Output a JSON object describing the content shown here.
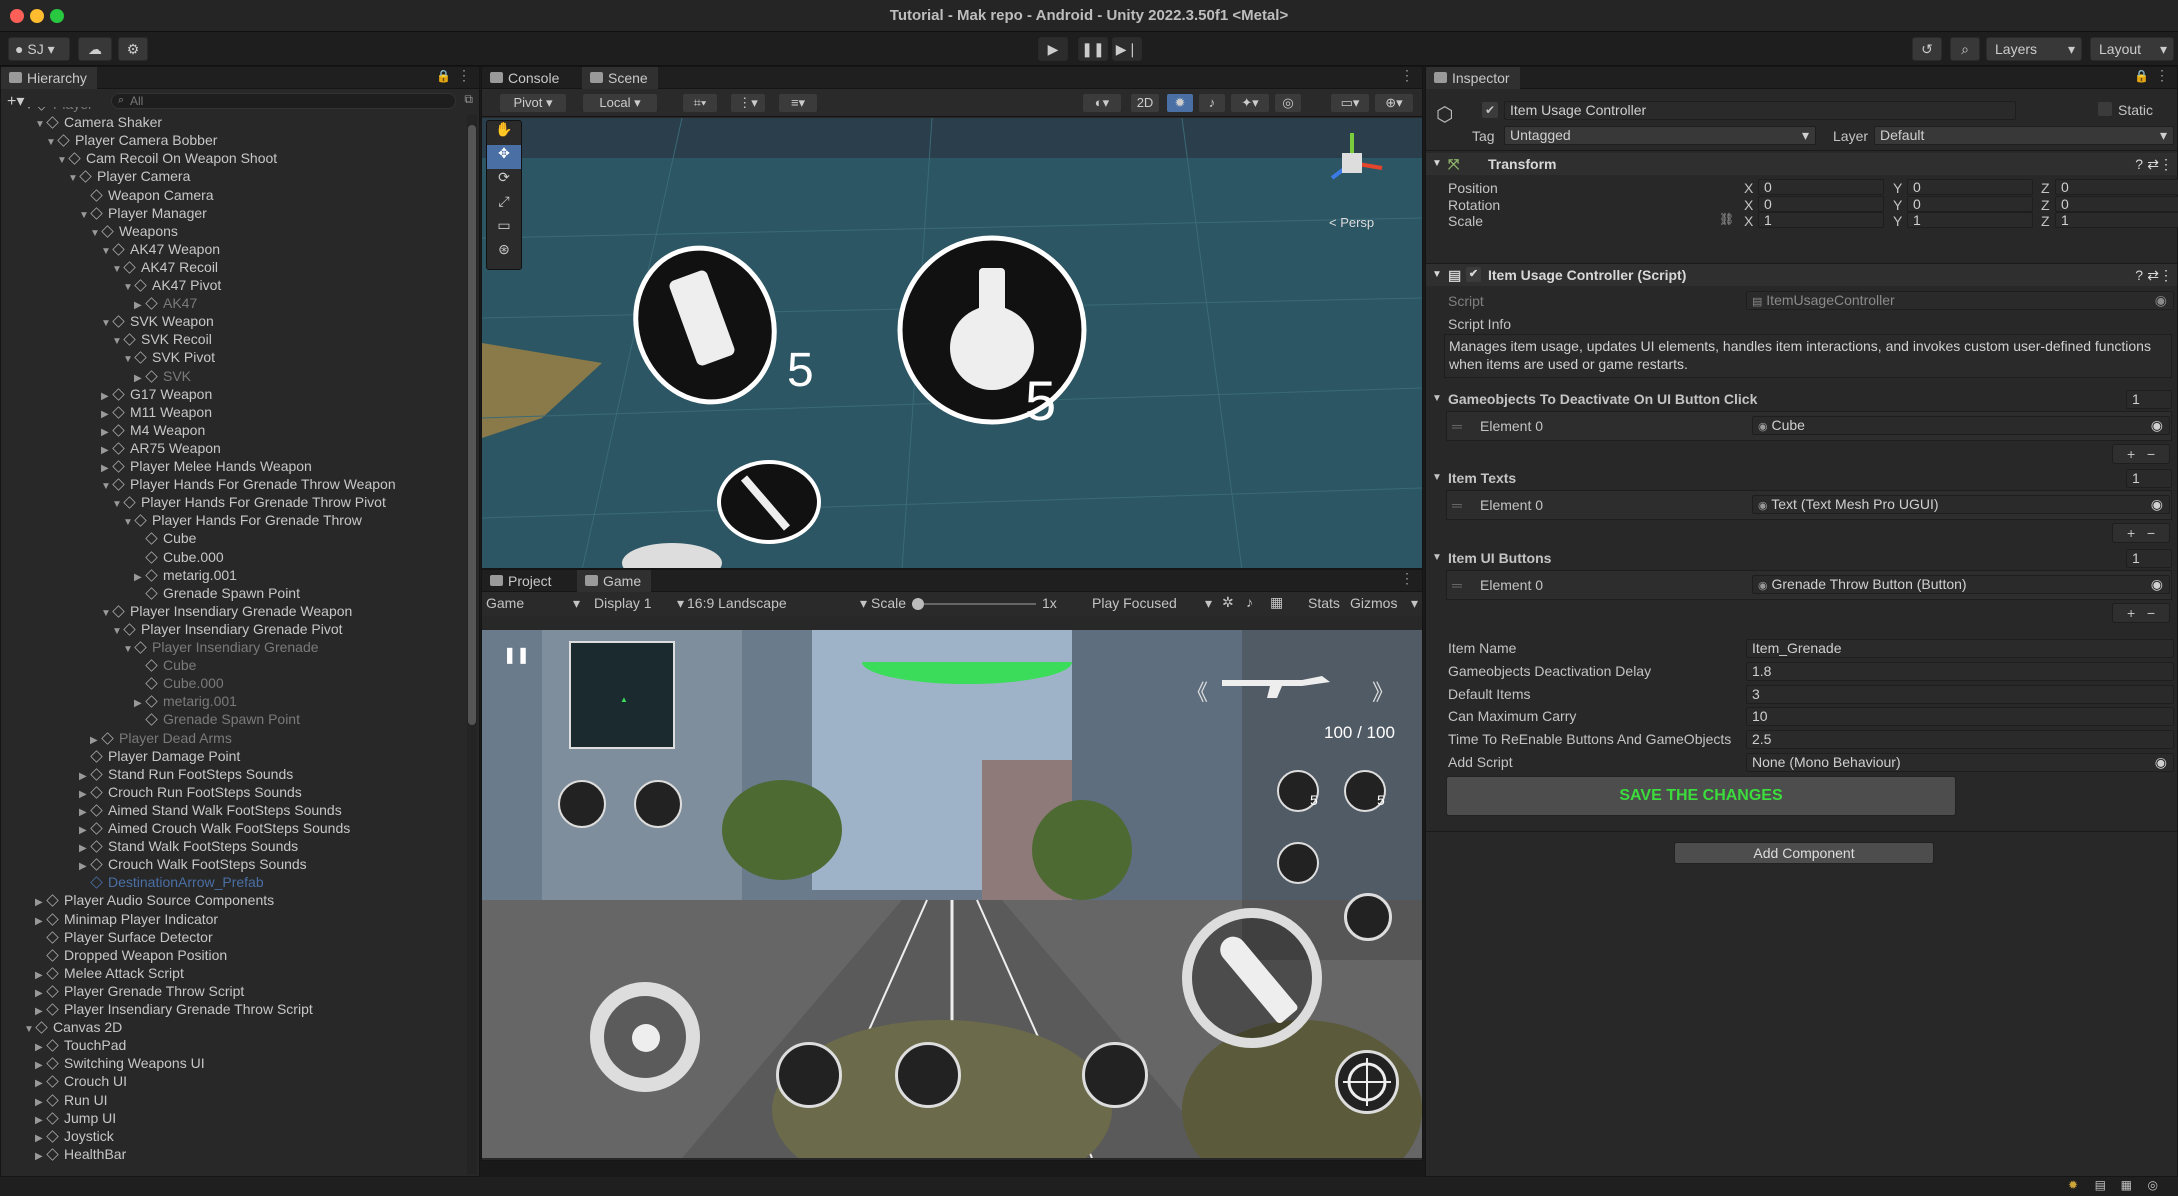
{
  "window": {
    "title": "Tutorial - Mak repo - Android - Unity 2022.3.50f1 <Metal>"
  },
  "toolbar": {
    "account": "SJ",
    "layers": "Layers",
    "layout": "Layout"
  },
  "hierarchy": {
    "tab": "Hierarchy",
    "search_placeholder": "All",
    "rows": [
      {
        "label": "Player",
        "indent": 3,
        "arrow": "▼",
        "style": "dim"
      },
      {
        "label": "Camera Shaker",
        "indent": 4,
        "arrow": "▼",
        "style": ""
      },
      {
        "label": "Player Camera Bobber",
        "indent": 5,
        "arrow": "▼",
        "style": ""
      },
      {
        "label": "Cam Recoil On Weapon Shoot",
        "indent": 6,
        "arrow": "▼",
        "style": ""
      },
      {
        "label": "Player Camera",
        "indent": 7,
        "arrow": "▼",
        "style": ""
      },
      {
        "label": "Weapon Camera",
        "indent": 8,
        "arrow": "",
        "style": ""
      },
      {
        "label": "Player Manager",
        "indent": 8,
        "arrow": "▼",
        "style": ""
      },
      {
        "label": "Weapons",
        "indent": 9,
        "arrow": "▼",
        "style": ""
      },
      {
        "label": "AK47 Weapon",
        "indent": 10,
        "arrow": "▼",
        "style": ""
      },
      {
        "label": "AK47 Recoil",
        "indent": 11,
        "arrow": "▼",
        "style": ""
      },
      {
        "label": "AK47 Pivot",
        "indent": 12,
        "arrow": "▼",
        "style": ""
      },
      {
        "label": "AK47",
        "indent": 13,
        "arrow": "▶",
        "style": "dim"
      },
      {
        "label": "SVK Weapon",
        "indent": 10,
        "arrow": "▼",
        "style": ""
      },
      {
        "label": "SVK Recoil",
        "indent": 11,
        "arrow": "▼",
        "style": ""
      },
      {
        "label": "SVK Pivot",
        "indent": 12,
        "arrow": "▼",
        "style": ""
      },
      {
        "label": "SVK",
        "indent": 13,
        "arrow": "▶",
        "style": "dim"
      },
      {
        "label": "G17 Weapon",
        "indent": 10,
        "arrow": "▶",
        "style": ""
      },
      {
        "label": "M11 Weapon",
        "indent": 10,
        "arrow": "▶",
        "style": ""
      },
      {
        "label": "M4 Weapon",
        "indent": 10,
        "arrow": "▶",
        "style": ""
      },
      {
        "label": "AR75 Weapon",
        "indent": 10,
        "arrow": "▶",
        "style": ""
      },
      {
        "label": "Player Melee Hands Weapon",
        "indent": 10,
        "arrow": "▶",
        "style": ""
      },
      {
        "label": "Player Hands For Grenade Throw Weapon",
        "indent": 10,
        "arrow": "▼",
        "style": ""
      },
      {
        "label": "Player Hands For Grenade Throw Pivot",
        "indent": 11,
        "arrow": "▼",
        "style": ""
      },
      {
        "label": "Player Hands For Grenade Throw",
        "indent": 12,
        "arrow": "▼",
        "style": ""
      },
      {
        "label": "Cube",
        "indent": 13,
        "arrow": "",
        "style": ""
      },
      {
        "label": "Cube.000",
        "indent": 13,
        "arrow": "",
        "style": ""
      },
      {
        "label": "metarig.001",
        "indent": 13,
        "arrow": "▶",
        "style": ""
      },
      {
        "label": "Grenade Spawn Point",
        "indent": 13,
        "arrow": "",
        "style": ""
      },
      {
        "label": "Player Insendiary Grenade Weapon",
        "indent": 10,
        "arrow": "▼",
        "style": ""
      },
      {
        "label": "Player Insendiary Grenade Pivot",
        "indent": 11,
        "arrow": "▼",
        "style": ""
      },
      {
        "label": "Player Insendiary Grenade",
        "indent": 12,
        "arrow": "▼",
        "style": "dim"
      },
      {
        "label": "Cube",
        "indent": 13,
        "arrow": "",
        "style": "dim"
      },
      {
        "label": "Cube.000",
        "indent": 13,
        "arrow": "",
        "style": "dim"
      },
      {
        "label": "metarig.001",
        "indent": 13,
        "arrow": "▶",
        "style": "dim"
      },
      {
        "label": "Grenade Spawn Point",
        "indent": 13,
        "arrow": "",
        "style": "dim"
      },
      {
        "label": "Player Dead Arms",
        "indent": 9,
        "arrow": "▶",
        "style": "dim"
      },
      {
        "label": "Player Damage Point",
        "indent": 8,
        "arrow": "",
        "style": ""
      },
      {
        "label": "Stand Run FootSteps Sounds",
        "indent": 8,
        "arrow": "▶",
        "style": ""
      },
      {
        "label": "Crouch Run FootSteps Sounds",
        "indent": 8,
        "arrow": "▶",
        "style": ""
      },
      {
        "label": "Aimed Stand Walk FootSteps Sounds",
        "indent": 8,
        "arrow": "▶",
        "style": ""
      },
      {
        "label": "Aimed Crouch Walk FootSteps Sounds",
        "indent": 8,
        "arrow": "▶",
        "style": ""
      },
      {
        "label": "Stand Walk FootSteps Sounds",
        "indent": 8,
        "arrow": "▶",
        "style": ""
      },
      {
        "label": "Crouch Walk FootSteps Sounds",
        "indent": 8,
        "arrow": "▶",
        "style": ""
      },
      {
        "label": "DestinationArrow_Prefab",
        "indent": 8,
        "arrow": "",
        "style": "blue"
      },
      {
        "label": "Player Audio Source Components",
        "indent": 4,
        "arrow": "▶",
        "style": ""
      },
      {
        "label": "Minimap Player Indicator",
        "indent": 4,
        "arrow": "▶",
        "style": ""
      },
      {
        "label": "Player Surface Detector",
        "indent": 4,
        "arrow": "",
        "style": ""
      },
      {
        "label": "Dropped Weapon Position",
        "indent": 4,
        "arrow": "",
        "style": ""
      },
      {
        "label": "Melee Attack Script",
        "indent": 4,
        "arrow": "▶",
        "style": ""
      },
      {
        "label": "Player Grenade Throw Script",
        "indent": 4,
        "arrow": "▶",
        "style": ""
      },
      {
        "label": "Player Insendiary Grenade Throw Script",
        "indent": 4,
        "arrow": "▶",
        "style": ""
      },
      {
        "label": "Canvas 2D",
        "indent": 3,
        "arrow": "▼",
        "style": ""
      },
      {
        "label": "TouchPad",
        "indent": 4,
        "arrow": "▶",
        "style": ""
      },
      {
        "label": "Switching Weapons UI",
        "indent": 4,
        "arrow": "▶",
        "style": ""
      },
      {
        "label": "Crouch UI",
        "indent": 4,
        "arrow": "▶",
        "style": ""
      },
      {
        "label": "Run UI",
        "indent": 4,
        "arrow": "▶",
        "style": ""
      },
      {
        "label": "Jump UI",
        "indent": 4,
        "arrow": "▶",
        "style": ""
      },
      {
        "label": "Joystick",
        "indent": 4,
        "arrow": "▶",
        "style": ""
      },
      {
        "label": "HealthBar",
        "indent": 4,
        "arrow": "▶",
        "style": ""
      }
    ]
  },
  "scene": {
    "tabs": [
      "Console",
      "Scene"
    ],
    "pivot": "Pivot",
    "local": "Local",
    "mode2d": "2D",
    "persp": "< Persp",
    "count_a": "5",
    "count_b": "5"
  },
  "game": {
    "tabs": [
      "Project",
      "Game"
    ],
    "display_mode": "Game",
    "display": "Display 1",
    "aspect": "16:9 Landscape",
    "scale_label": "Scale",
    "scale_value": "1x",
    "play_focused": "Play Focused",
    "stats": "Stats",
    "gizmos": "Gizmos",
    "ammo": "100 / 100",
    "count_a": "5",
    "count_b": "5",
    "health_fraction": 0.8
  },
  "inspector": {
    "tab": "Inspector",
    "object_name": "Item Usage Controller",
    "static": "Static",
    "tag_label": "Tag",
    "tag": "Untagged",
    "layer_label": "Layer",
    "layer": "Default",
    "transform": {
      "title": "Transform",
      "rows": [
        {
          "label": "Position",
          "x": "0",
          "y": "0",
          "z": "0"
        },
        {
          "label": "Rotation",
          "x": "0",
          "y": "0",
          "z": "0"
        },
        {
          "label": "Scale",
          "x": "1",
          "y": "1",
          "z": "1"
        }
      ]
    },
    "script": {
      "title": "Item Usage Controller (Script)",
      "script_label": "Script",
      "script_value": "ItemUsageController",
      "info_label": "Script Info",
      "info_text": "Manages item usage, updates UI elements, handles item interactions, and invokes custom user-defined functions when items are used or game restarts."
    },
    "lists": [
      {
        "title": "Gameobjects To Deactivate On UI Button Click",
        "count": "1",
        "element": "Element 0",
        "value": "Cube"
      },
      {
        "title": "Item Texts",
        "count": "1",
        "element": "Element 0",
        "value": "Text (Text Mesh Pro UGUI)"
      },
      {
        "title": "Item UI Buttons",
        "count": "1",
        "element": "Element 0",
        "value": "Grenade Throw Button (Button)"
      }
    ],
    "props": [
      {
        "label": "Item Name",
        "value": "Item_Grenade"
      },
      {
        "label": "Gameobjects Deactivation Delay",
        "value": "1.8"
      },
      {
        "label": "Default Items",
        "value": "3"
      },
      {
        "label": "Can Maximum Carry",
        "value": "10"
      },
      {
        "label": "Time To ReEnable Buttons And GameObjects",
        "value": "2.5"
      },
      {
        "label": "Add Script",
        "value": "None (Mono Behaviour)"
      }
    ],
    "save_button": "SAVE THE CHANGES",
    "add_component": "Add Component"
  },
  "colors": {
    "save_green": "#3bdc3b",
    "health_green": "#3bdc5a",
    "selected_blue": "#4a6fa5"
  }
}
